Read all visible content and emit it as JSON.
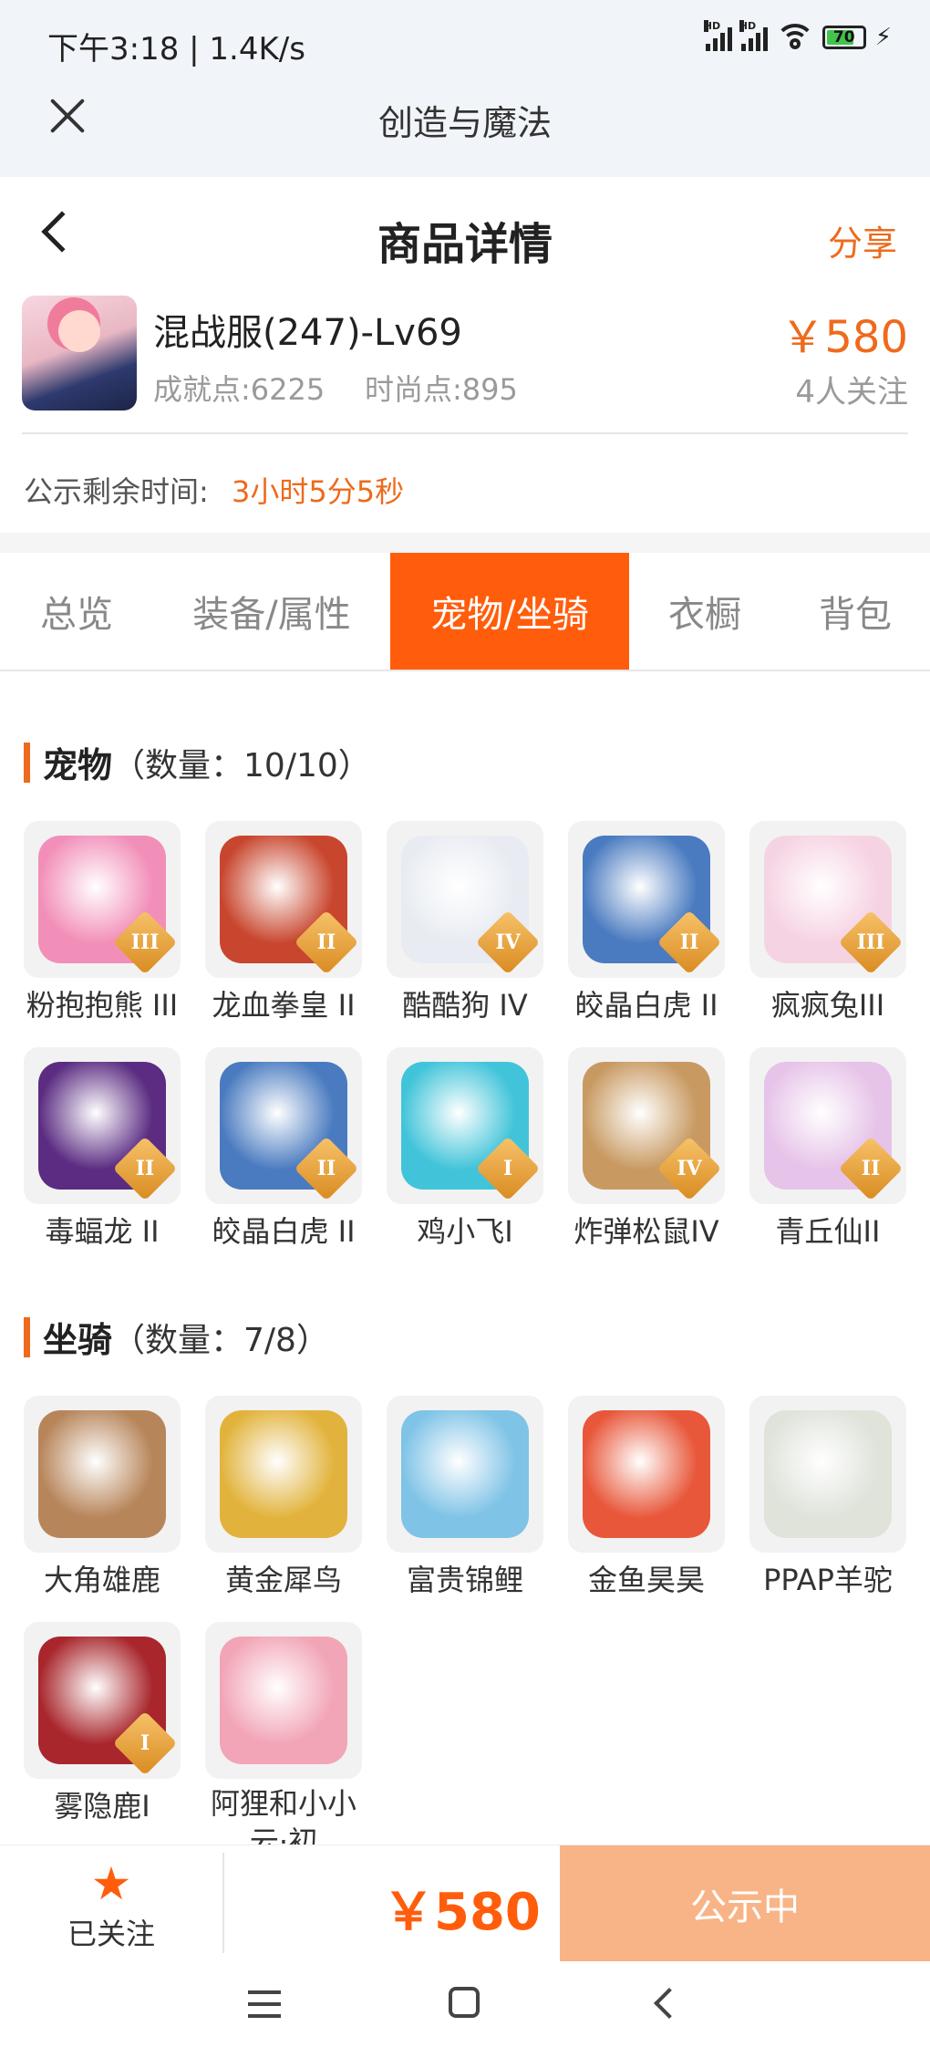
{
  "status_bar": {
    "time": "下午3:18 | 1.4K/s",
    "battery": "70"
  },
  "browser": {
    "title": "创造与魔法"
  },
  "header": {
    "title": "商品详情",
    "share_label": "分享"
  },
  "product": {
    "name": "混战服(247)-Lv69",
    "achievement": "成就点:6225",
    "fashion": "时尚点:895",
    "price": "￥580",
    "followers": "4人关注"
  },
  "publicity": {
    "label": "公示剩余时间:",
    "value": "3小时5分5秒"
  },
  "tabs": [
    {
      "label": "总览",
      "active": false
    },
    {
      "label": "装备/属性",
      "active": false
    },
    {
      "label": "宠物/坐骑",
      "active": true
    },
    {
      "label": "衣橱",
      "active": false
    },
    {
      "label": "背包",
      "active": false
    }
  ],
  "pets": {
    "title": "宠物",
    "count": "（数量：10/10）",
    "items": [
      {
        "name": "粉抱抱熊 III",
        "rank": "III",
        "color": "#f28fb9"
      },
      {
        "name": "龙血拳皇 II",
        "rank": "II",
        "color": "#c8462e"
      },
      {
        "name": "酷酷狗 IV",
        "rank": "IV",
        "color": "#e8ecf2"
      },
      {
        "name": "皎晶白虎 II",
        "rank": "II",
        "color": "#4a7bc0"
      },
      {
        "name": "疯疯兔III",
        "rank": "III",
        "color": "#f6d3e3"
      },
      {
        "name": "毒蝠龙 II",
        "rank": "II",
        "color": "#5b2c82"
      },
      {
        "name": "皎晶白虎 II",
        "rank": "II",
        "color": "#4a7bc0"
      },
      {
        "name": "鸡小飞I",
        "rank": "I",
        "color": "#41c4d9"
      },
      {
        "name": "炸弹松鼠IV",
        "rank": "IV",
        "color": "#c89a62"
      },
      {
        "name": "青丘仙II",
        "rank": "II",
        "color": "#e6c3e8"
      }
    ]
  },
  "mounts": {
    "title": "坐骑",
    "count": "（数量：7/8）",
    "items": [
      {
        "name": "大角雄鹿",
        "rank": "",
        "color": "#b7855a"
      },
      {
        "name": "黄金犀鸟",
        "rank": "",
        "color": "#e2b33c"
      },
      {
        "name": "富贵锦鲤",
        "rank": "",
        "color": "#7fc3e6"
      },
      {
        "name": "金鱼昊昊",
        "rank": "",
        "color": "#e8573a"
      },
      {
        "name": "PPAP羊驼",
        "rank": "",
        "color": "#dfe3da"
      },
      {
        "name": "雾隐鹿I",
        "rank": "I",
        "color": "#a8262c"
      },
      {
        "name": "阿狸和小小云·初",
        "rank": "",
        "color": "#f2a5b6"
      }
    ]
  },
  "bottom": {
    "follow_label": "已关注",
    "price": "￥580",
    "status_label": "公示中"
  },
  "colors": {
    "accent": "#ff5d0c",
    "accent_text": "#ee6a1c",
    "status_btn": "#f8b487"
  }
}
